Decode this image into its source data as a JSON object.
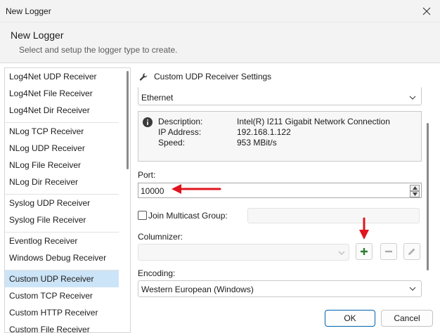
{
  "window": {
    "title": "New Logger"
  },
  "header": {
    "title": "New Logger",
    "subtitle": "Select and setup the logger type to create."
  },
  "logger_types": [
    {
      "label": "Log4Net UDP Receiver",
      "group_end": false
    },
    {
      "label": "Log4Net File Receiver",
      "group_end": false
    },
    {
      "label": "Log4Net Dir Receiver",
      "group_end": true
    },
    {
      "label": "NLog TCP Receiver",
      "group_end": false
    },
    {
      "label": "NLog UDP Receiver",
      "group_end": false
    },
    {
      "label": "NLog File Receiver",
      "group_end": false
    },
    {
      "label": "NLog Dir Receiver",
      "group_end": true
    },
    {
      "label": "Syslog UDP Receiver",
      "group_end": false
    },
    {
      "label": "Syslog File Receiver",
      "group_end": true
    },
    {
      "label": "Eventlog Receiver",
      "group_end": false
    },
    {
      "label": "Windows Debug Receiver",
      "group_end": true
    },
    {
      "label": "Custom UDP Receiver",
      "group_end": false,
      "selected": true
    },
    {
      "label": "Custom TCP Receiver",
      "group_end": false
    },
    {
      "label": "Custom HTTP Receiver",
      "group_end": false
    },
    {
      "label": "Custom File Receiver",
      "group_end": false
    }
  ],
  "settings": {
    "title": "Custom UDP Receiver Settings",
    "icon": "wrench-icon",
    "network_adapter": "Ethernet",
    "network_info": {
      "description_label": "Description:",
      "description_value": "Intel(R) I211 Gigabit Network Connection",
      "ip_label": "IP Address:",
      "ip_value": "192.168.1.122",
      "speed_label": "Speed:",
      "speed_value": "953 MBit/s"
    },
    "port_label": "Port:",
    "port_value": "10000",
    "multicast_label": "Join Multicast Group:",
    "multicast_checked": false,
    "columnizer_label": "Columnizer:",
    "columnizer_value": "",
    "encoding_label": "Encoding:",
    "encoding_value": "Western European (Windows)"
  },
  "buttons": {
    "ok": "OK",
    "cancel": "Cancel"
  },
  "colors": {
    "selection": "#cce4f7",
    "annotation_arrow": "#e0141e",
    "add_icon": "#2e7d32",
    "primary_border": "#0063b1"
  }
}
